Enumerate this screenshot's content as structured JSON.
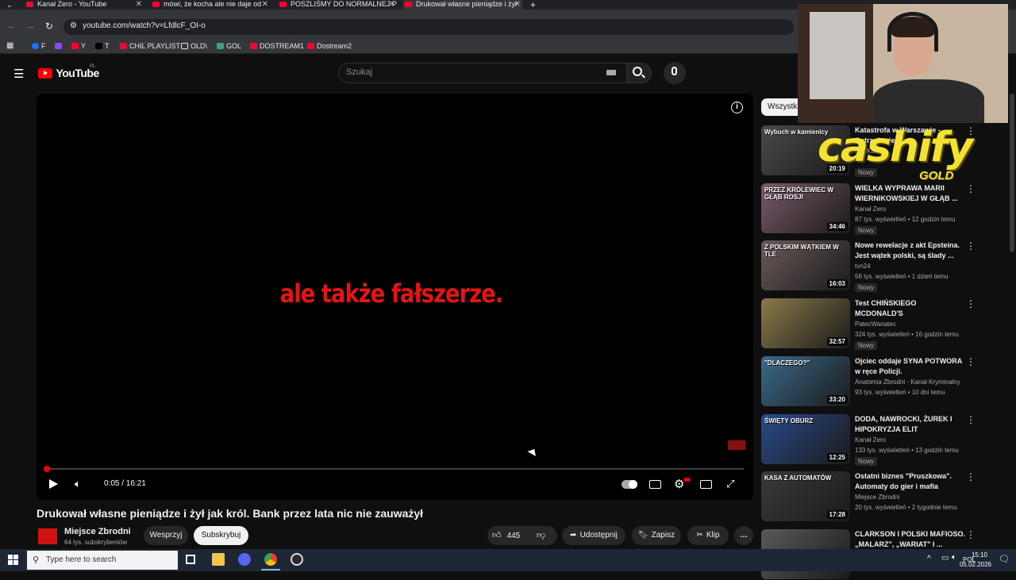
{
  "browser": {
    "tabs": [
      {
        "title": "Kanał Zero - YouTube",
        "active": false
      },
      {
        "title": "mówi, że kocha ale nie daje od",
        "active": false
      },
      {
        "title": "POSZLIŚMY DO NORMALNEJ P",
        "active": false
      },
      {
        "title": "Drukował własne pieniądze i żył",
        "active": true
      }
    ],
    "new_tab": "+",
    "url": "youtube.com/watch?v=LfdlcF_OI-o",
    "bookmarks": [
      {
        "label": "F",
        "color": "#1877f2"
      },
      {
        "label": "",
        "color": "#9146ff"
      },
      {
        "label": "Y",
        "color": "#ff0033"
      },
      {
        "label": "T",
        "color": "#000000"
      },
      {
        "label": "CHIL PLAYLIST",
        "color": "#ff0033"
      },
      {
        "label": "OLD\\",
        "color": "#35363a"
      },
      {
        "label": "GOL",
        "color": "#3aa57a"
      },
      {
        "label": "DOSTREAM1",
        "color": "#ff0033"
      },
      {
        "label": "Dostream2",
        "color": "#ff0033"
      }
    ]
  },
  "youtube": {
    "logo": "YouTube",
    "region": "PL",
    "search_placeholder": "Szukaj",
    "player": {
      "caption": "ale także fałszerze.",
      "time": "0:05 / 16:21",
      "progress": 0.005
    },
    "video": {
      "title": "Drukował własne pieniądze i żył jak król. Bank przez lata nic nie zauważył",
      "channel": "Miejsce Zbrodni",
      "subs": "64 tys. subskrybentów",
      "support_label": "Wesprzyj",
      "subscribe_label": "Subskrybuj",
      "likes": "445",
      "share_label": "Udostępnij",
      "save_label": "Zapisz",
      "clip_label": "Klip",
      "more": "…"
    },
    "chip": "Wszystkie",
    "recommendations": [
      {
        "title": "Katastrofa w Warszawie - Ostrzeżenie",
        "channel": "Oto Kanał",
        "meta": "",
        "badge": "Nowy",
        "duration": "20:19",
        "thumb_text": "Wybuch w kamienicy",
        "thumb_color": "#4a4a4a"
      },
      {
        "title": "WIELKA WYPRAWA MARII WIERNIKOWSKIEJ W GŁĄB ...",
        "channel": "Kanał Zero",
        "meta": "87 tys. wyświetleń • 12 godzin temu",
        "badge": "Nowy",
        "duration": "34:46",
        "thumb_text": "PRZEZ KRÓLEWIEC W GŁĄB ROSJI",
        "thumb_color": "#7a5a6a"
      },
      {
        "title": "Nowe rewelacje z akt Epsteina. Jest wątek polski, są ślady ...",
        "channel": "tvn24",
        "meta": "56 tys. wyświetleń • 1 dzień temu",
        "badge": "Nowy",
        "duration": "16:03",
        "thumb_text": "Z POLSKIM WĄTKIEM W TLE",
        "thumb_color": "#6a5a5a"
      },
      {
        "title": "Test CHIŃSKIEGO MCDONALD'S",
        "channel": "PatecWariatec",
        "meta": "324 tys. wyświetleń • 16 godzin temu",
        "badge": "Nowy",
        "duration": "32:57",
        "thumb_text": "",
        "thumb_color": "#8a7a4a"
      },
      {
        "title": "Ojciec oddaje SYNA POTWORA w ręce Policji.",
        "channel": "Anatomia Zbrodni - Kanał Kryminalny",
        "meta": "93 tys. wyświetleń • 10 dni temu",
        "badge": "",
        "duration": "33:20",
        "thumb_text": "\"DLACZEGO?\"",
        "thumb_color": "#3a6a8a"
      },
      {
        "title": "DODA, NAWROCKI, ŻUREK I HIPOKRYZJA ELIT",
        "channel": "Kanał Zero",
        "meta": "133 tys. wyświetleń • 13 godzin temu",
        "badge": "Nowy",
        "duration": "12:25",
        "thumb_text": "ŚWIĘTY OBURZ",
        "thumb_color": "#2a4a8a"
      },
      {
        "title": "Ostatni biznes \"Pruszkowa\". Automaty do gier i mafia",
        "channel": "Miejsce Zbrodni",
        "meta": "20 tys. wyświetleń • 2 tygodnie temu",
        "badge": "",
        "duration": "17:28",
        "thumb_text": "KASA Z AUTOMATÓW",
        "thumb_color": "#3a3a3a"
      },
      {
        "title": "CLARKSON I POLSKI MAFIOSO. „MALARZ\", „WARIAT\" I ...",
        "channel": "",
        "meta": "",
        "badge": "",
        "duration": "",
        "thumb_text": "",
        "thumb_color": "#5a5a5a"
      }
    ]
  },
  "overlay": {
    "brand": "cashify",
    "brand_sub": "GOLD"
  },
  "taskbar": {
    "search_placeholder": "Type here to search",
    "lang": "POL",
    "time": "15:10",
    "date": "05.02.2026"
  }
}
